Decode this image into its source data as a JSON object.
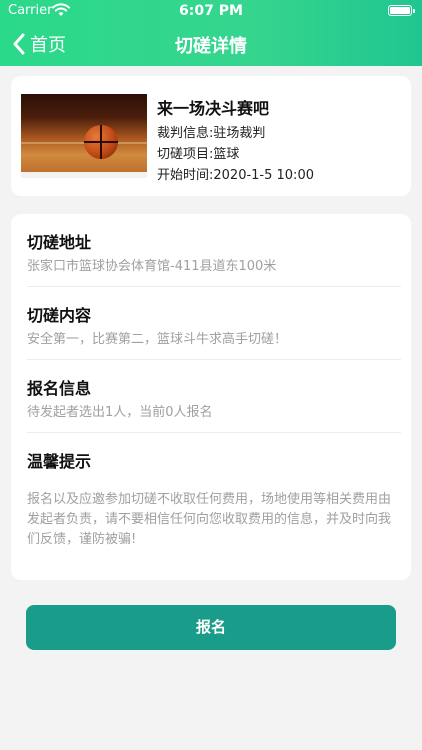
{
  "status_bar": {
    "carrier": "Carrier",
    "time": "6:07 PM"
  },
  "nav": {
    "back_label": "首页",
    "title": "切磋详情"
  },
  "match": {
    "title": "来一场决斗赛吧",
    "referee": "裁判信息:驻场裁判",
    "sport": "切磋项目:篮球",
    "start_time": "开始时间:2020-1-5 10:00"
  },
  "sections": {
    "address": {
      "title": "切磋地址",
      "text": "张家口市篮球协会体育馆-411县道东100米"
    },
    "content": {
      "title": "切磋内容",
      "text": "安全第一，比赛第二，篮球斗牛求高手切磋！"
    },
    "signup_info": {
      "title": "报名信息",
      "text": "待发起者选出1人，当前0人报名"
    },
    "tips": {
      "title": "温馨提示",
      "text": "报名以及应邀参加切磋不收取任何费用，场地使用等相关费用由发起者负责，请不要相信任何向您收取费用的信息，并及时向我们反馈，谨防被骗!"
    }
  },
  "signup_button": {
    "label": "报名"
  },
  "colors": {
    "header": "#2ed98b",
    "button": "#1a9c8a"
  }
}
